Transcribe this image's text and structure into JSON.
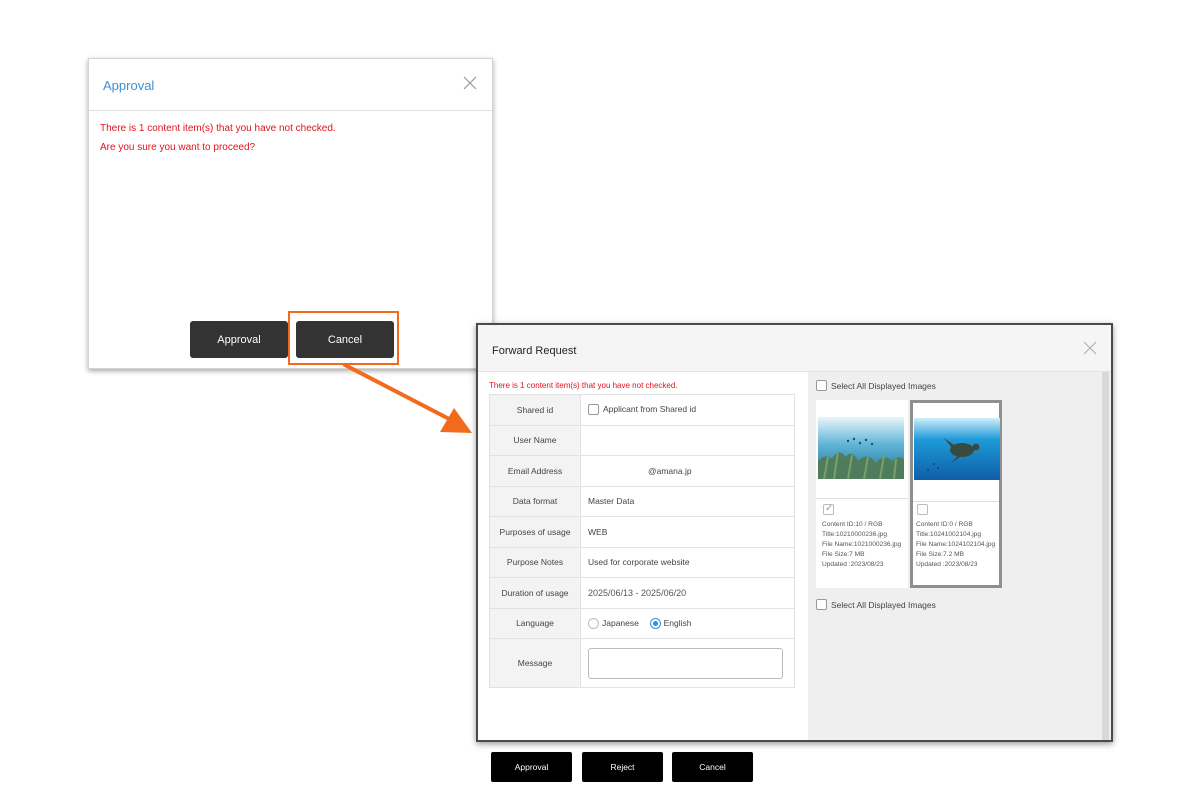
{
  "approval_dialog": {
    "title": "Approval",
    "warning_line1": "There is 1 content item(s) that you have not checked.",
    "warning_line2": "Are you sure you want to proceed?",
    "approval_label": "Approval",
    "cancel_label": "Cancel"
  },
  "forward_request": {
    "title": "Forward Request",
    "warning": "There is 1 content item(s) that you have not checked.",
    "fields": {
      "shared_id": {
        "label": "Shared id",
        "checkbox_label": "Applicant from Shared id"
      },
      "user_name": {
        "label": "User Name",
        "value": ""
      },
      "email": {
        "label": "Email Address",
        "value": "@amana.jp"
      },
      "data_format": {
        "label": "Data format",
        "value": "Master Data"
      },
      "purposes": {
        "label": "Purposes of usage",
        "value": "WEB"
      },
      "purpose_notes": {
        "label": "Purpose Notes",
        "value": "Used for corporate website"
      },
      "duration": {
        "label": "Duration of usage",
        "value": "2025/06/13 - 2025/06/20"
      },
      "language": {
        "label": "Language",
        "option_japanese": "Japanese",
        "option_english": "English",
        "selected": "English"
      },
      "message": {
        "label": "Message",
        "value": ""
      }
    },
    "buttons": {
      "approval": "Approval",
      "reject": "Reject",
      "cancel": "Cancel"
    },
    "images_panel": {
      "select_all_label": "Select All Displayed Images",
      "cards": [
        {
          "checked": true,
          "content_id": "Content ID:10 / RGB",
          "title": "Title:10210000236.jpg",
          "file_name": "File Name:10210002​36.jpg",
          "file_size": "File Size:7 MB",
          "updated": "Updated :2023/08/23"
        },
        {
          "checked": false,
          "content_id": "Content ID:0 / RGB",
          "title": "Title:10241002104.jpg",
          "file_name": "File Name:10241021​04.jpg",
          "file_size": "File Size:7.2 MB",
          "updated": "Updated :2023/08/23"
        }
      ]
    }
  },
  "colors": {
    "warning": "#e0141e",
    "title_blue": "#3d8fd6",
    "highlight_orange": "#f26b1d",
    "radio_blue": "#2d8ff0"
  }
}
